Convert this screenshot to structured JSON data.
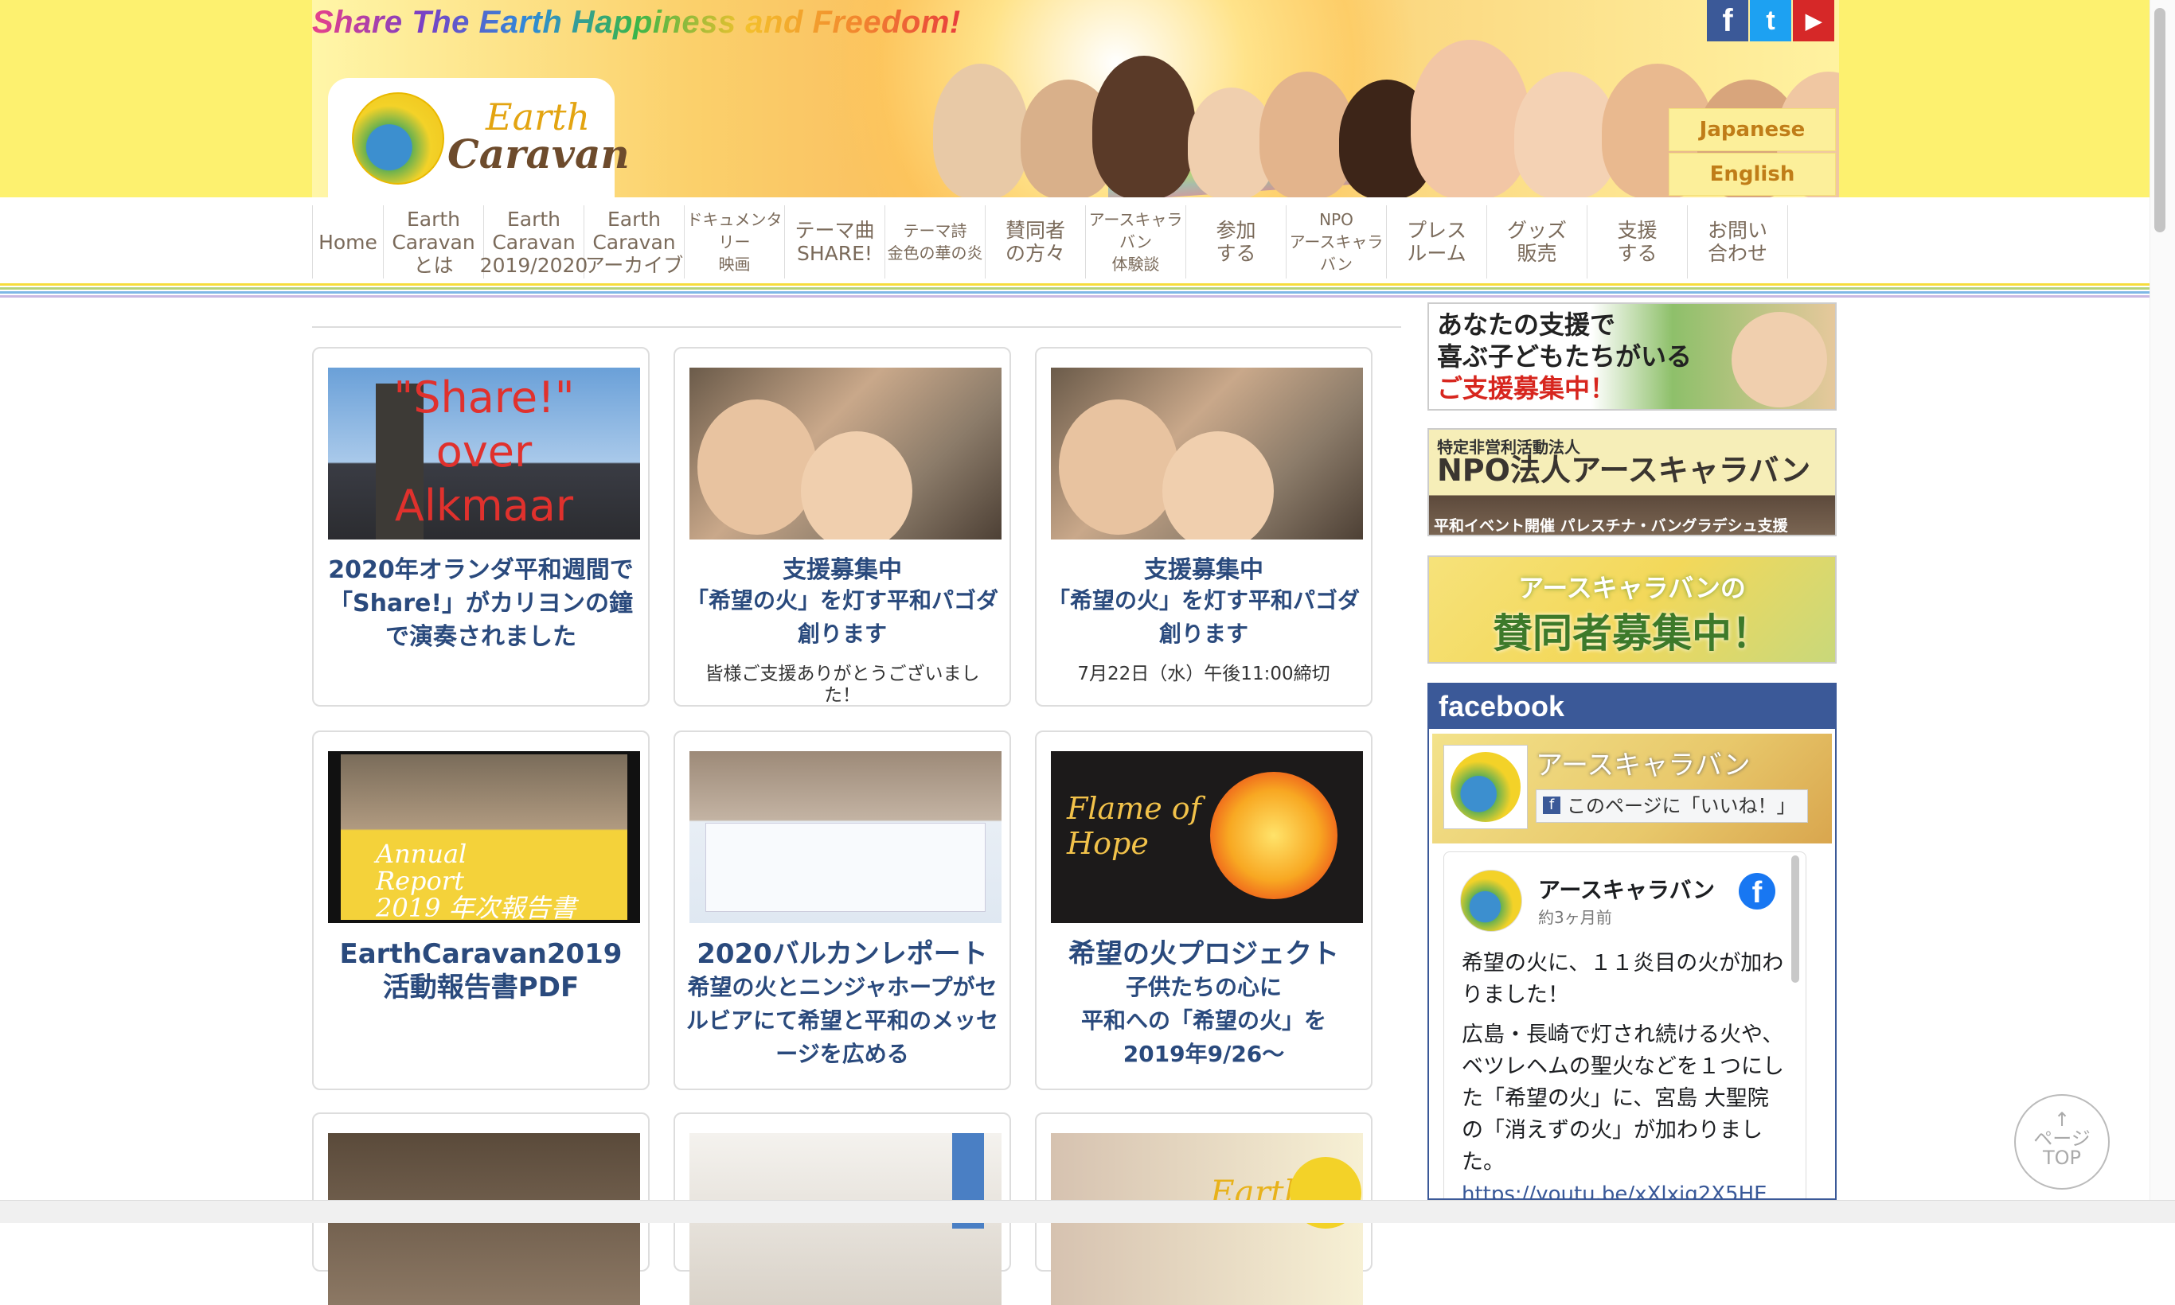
{
  "header": {
    "tagline": "Share The Earth Happiness and Freedom!",
    "logo": {
      "line1": "Earth",
      "line2": "Caravan"
    },
    "social": [
      {
        "name": "facebook",
        "glyph": "f",
        "color": "#3b5998"
      },
      {
        "name": "twitter",
        "glyph": "t",
        "color": "#1da1f2"
      },
      {
        "name": "youtube",
        "glyph": "▶",
        "color": "#d62828"
      }
    ],
    "languages": [
      "Japanese",
      "English"
    ]
  },
  "nav": {
    "items": [
      "Home",
      "Earth\nCaravan\nとは",
      "Earth\nCaravan\n2019/2020",
      "Earth\nCaravan\nアーカイブ",
      "ドキュメンタリー\n映画",
      "テーマ曲\nSHARE!",
      "テーマ詩\n金色の華の炎",
      "賛同者\nの方々",
      "アースキャラバン\n体験談",
      "参加\nする",
      "NPO\nアースキャラバン",
      "プレス\nルーム",
      "グッズ\n販売",
      "支援\nする",
      "お問い\n合わせ"
    ]
  },
  "cards": [
    {
      "image_text": "\"Share!\"\nover\nAlkmaar",
      "title": "2020年オランダ平和週間で「Share!」がカリヨンの鐘で演奏されました",
      "body": "",
      "note": ""
    },
    {
      "image_text": "",
      "title": "支援募集中",
      "body": "「希望の火」を灯す平和パゴダ創ります",
      "note": "皆様ご支援ありがとうございました！"
    },
    {
      "image_text": "",
      "title": "支援募集中",
      "body": "「希望の火」を灯す平和パゴダ創ります",
      "note": "7月22日（水）午後11:00締切"
    },
    {
      "image_text": "Annual\nReport\n2019 年次報告書",
      "title": "EarthCaravan2019\n活動報告書PDF",
      "body": "",
      "note": ""
    },
    {
      "image_text": "",
      "title": "2020バルカンレポート",
      "body": "希望の火とニンジャホープがセルビアにて希望と平和のメッセージを広める",
      "note": ""
    },
    {
      "image_text": "Flame of Hope",
      "title": "希望の火プロジェクト",
      "body": "子供たちの心に\n平和への「希望の火」を\n2019年9/26〜",
      "note": ""
    },
    {
      "image_text": "",
      "title": "",
      "body": "",
      "note": ""
    },
    {
      "image_text": "",
      "title": "",
      "body": "",
      "note": ""
    },
    {
      "image_text": "Earth",
      "title": "",
      "body": "",
      "note": ""
    }
  ],
  "sidebar": {
    "banners": [
      {
        "lines": [
          "あなたの支援で",
          "喜ぶ子どもたちがいる",
          "ご支援募集中！"
        ]
      },
      {
        "lines": [
          "特定非営利活動法人",
          "NPO法人アースキャラバン",
          "平和イベント開催 パレスチナ・バングラデシュ支援"
        ]
      },
      {
        "lines": [
          "アースキャラバンの",
          "賛同者募集中！"
        ]
      }
    ],
    "facebook": {
      "heading": "facebook",
      "page_name": "アースキャラバン",
      "like_button": "このページに「いいね！」",
      "post_author": "アースキャラバン",
      "post_time": "約3ヶ月前",
      "post_lines": [
        "希望の火に、１１炎目の火が加わりました！",
        "広島・長崎で灯され続ける火や、ベツレヘムの聖火などを１つにした「希望の火」に、宮島 大聖院の「消えずの火」が加わりました。"
      ],
      "post_link": "https://youtu.be/xXlxjg2X5HE"
    }
  },
  "pagetop": {
    "arrow": "↑",
    "label1": "ページ",
    "label2": "TOP"
  }
}
